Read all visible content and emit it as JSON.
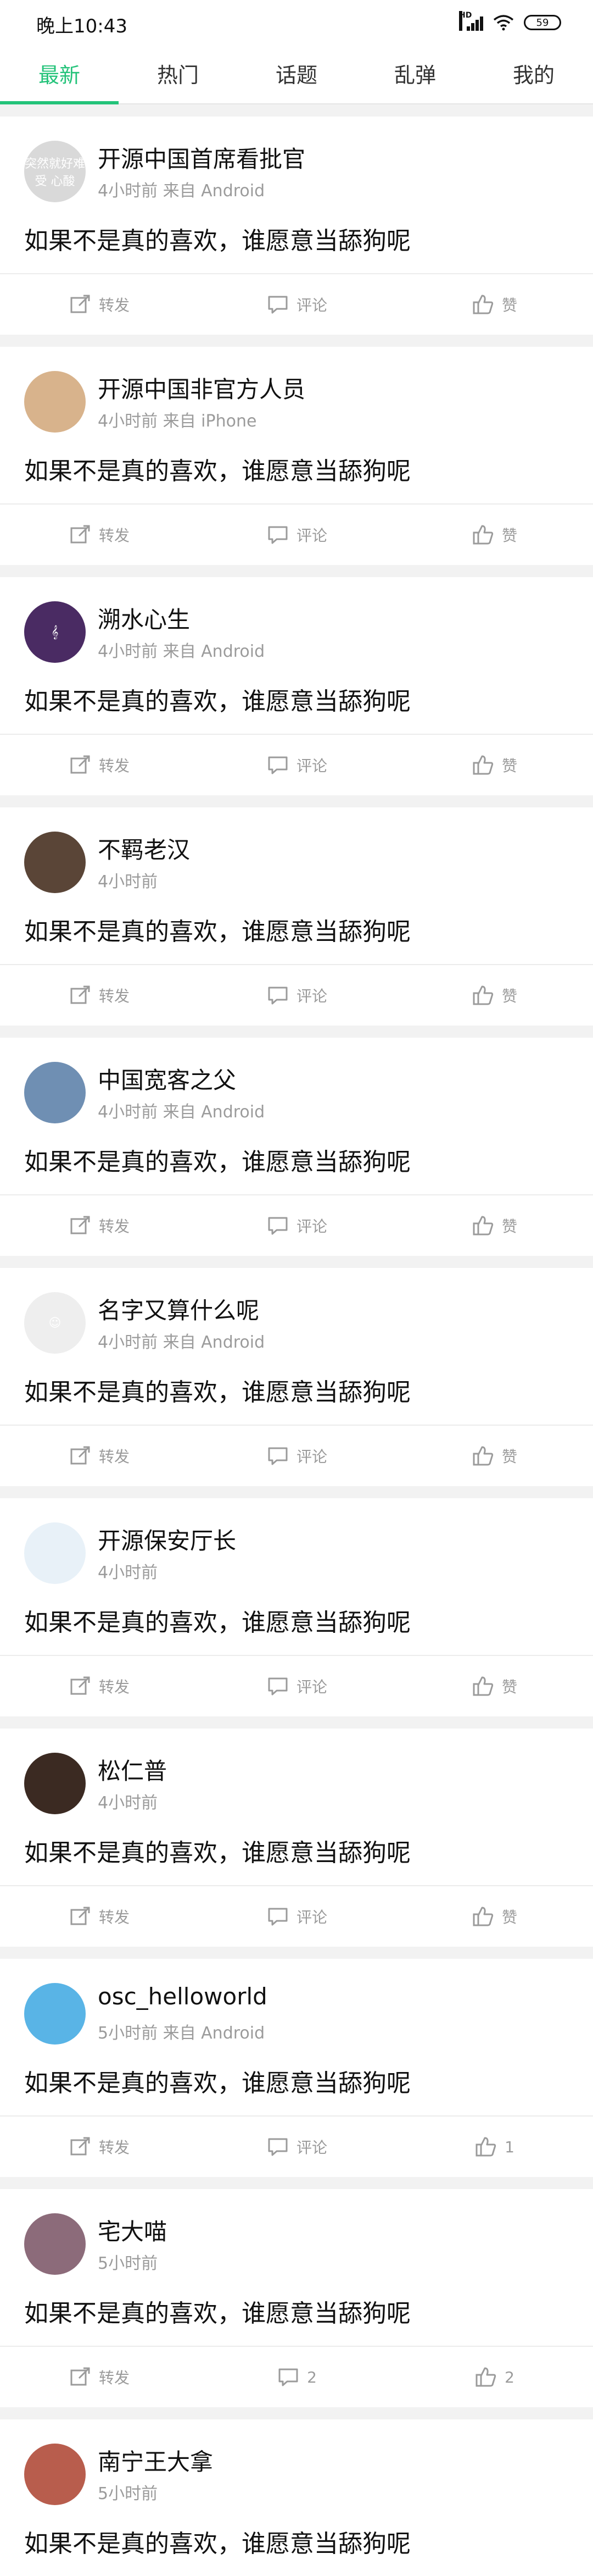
{
  "status": {
    "time": "晚上10:43",
    "hd": "HD",
    "battery": "59"
  },
  "tabs": [
    {
      "label": "最新",
      "active": true
    },
    {
      "label": "热门",
      "active": false
    },
    {
      "label": "话题",
      "active": false
    },
    {
      "label": "乱弹",
      "active": false
    },
    {
      "label": "我的",
      "active": false
    }
  ],
  "posts": [
    {
      "author": "开源中国首席看批官",
      "meta": "4小时前  来自 Android",
      "content": "如果不是真的喜欢，谁愿意当舔狗呢",
      "forward": "转发",
      "comment": "评论",
      "like": "赞",
      "avatar_color": "#d9d9d9",
      "avatar_text": "突然就好难受 心酸"
    },
    {
      "author": "开源中国非官方人员",
      "meta": "4小时前  来自 iPhone",
      "content": "如果不是真的喜欢，谁愿意当舔狗呢",
      "forward": "转发",
      "comment": "评论",
      "like": "赞",
      "avatar_color": "#d8b38c",
      "avatar_text": ""
    },
    {
      "author": "溯水心生",
      "meta": "4小时前  来自 Android",
      "content": "如果不是真的喜欢，谁愿意当舔狗呢",
      "forward": "转发",
      "comment": "评论",
      "like": "赞",
      "avatar_color": "#4a2b63",
      "avatar_text": "𝄞"
    },
    {
      "author": "不羁老汉",
      "meta": "4小时前",
      "content": "如果不是真的喜欢，谁愿意当舔狗呢",
      "forward": "转发",
      "comment": "评论",
      "like": "赞",
      "avatar_color": "#5a4537",
      "avatar_text": ""
    },
    {
      "author": "中国宽客之父",
      "meta": "4小时前  来自 Android",
      "content": "如果不是真的喜欢，谁愿意当舔狗呢",
      "forward": "转发",
      "comment": "评论",
      "like": "赞",
      "avatar_color": "#6f8fb3",
      "avatar_text": ""
    },
    {
      "author": "名字又算什么呢",
      "meta": "4小时前  来自 Android",
      "content": "如果不是真的喜欢，谁愿意当舔狗呢",
      "forward": "转发",
      "comment": "评论",
      "like": "赞",
      "avatar_color": "#eeeeee",
      "avatar_text": "☺"
    },
    {
      "author": "开源保安厅长",
      "meta": "4小时前",
      "content": "如果不是真的喜欢，谁愿意当舔狗呢",
      "forward": "转发",
      "comment": "评论",
      "like": "赞",
      "avatar_color": "#e8f1f8",
      "avatar_text": ""
    },
    {
      "author": "松仁普",
      "meta": "4小时前",
      "content": "如果不是真的喜欢，谁愿意当舔狗呢",
      "forward": "转发",
      "comment": "评论",
      "like": "赞",
      "avatar_color": "#3b2a22",
      "avatar_text": ""
    },
    {
      "author": "osc_helloworld",
      "meta": "5小时前  来自 Android",
      "content": "如果不是真的喜欢，谁愿意当舔狗呢",
      "forward": "转发",
      "comment": "评论",
      "like": "1",
      "avatar_color": "#59b4e6",
      "avatar_text": ""
    },
    {
      "author": "宅大喵",
      "meta": "5小时前",
      "content": "如果不是真的喜欢，谁愿意当舔狗呢",
      "forward": "转发",
      "comment": "2",
      "like": "2",
      "avatar_color": "#8c6b7a",
      "avatar_text": ""
    },
    {
      "author": "南宁王大拿",
      "meta": "5小时前",
      "content": "如果不是真的喜欢，谁愿意当舔狗呢",
      "forward": "",
      "comment": "",
      "like": "",
      "avatar_color": "#b85d4d",
      "avatar_text": ""
    }
  ]
}
